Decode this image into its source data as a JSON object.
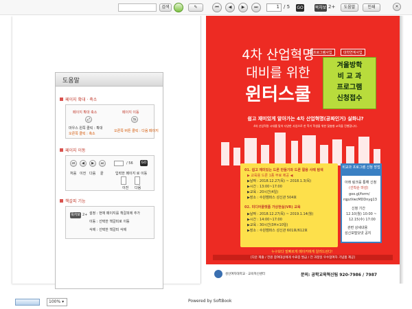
{
  "toolbar": {
    "search_button_label": "검색",
    "page_current": "1",
    "page_total": "/ 5",
    "go_label": "GO",
    "tab_label": "목차보기",
    "tab_extra": "2+",
    "help_label": "도움말",
    "print_label": "인쇄"
  },
  "help": {
    "title": "도움말",
    "section1": "페이지 확대 · 축소",
    "s1_left": "페이지 확대 축소",
    "s1_left_desc": "마우스 왼쪽 클릭 : 확대",
    "s1_left_desc2": "오른쪽 클릭 : 축소",
    "s1_right": "페이지 이동",
    "s1_right_desc": "오른쪽 버튼 클릭 : 다음 페이지",
    "section2": "페이지 이동",
    "s2_page": "/ 56",
    "s2_go": "GO",
    "s2_first": "처음",
    "s2_prev": "이전",
    "s2_next": "다음",
    "s2_last": "끝",
    "s2_input_desc": "입력한 페이지 로 이동",
    "s2_prev2": "이전",
    "s2_next2": "다음",
    "section3": "책갈피 기능",
    "s3_tab": "목차보기",
    "s3_tab_extra": "2+",
    "s3_line1": "설정 : 현재 페이지를 책갈피에 추가",
    "s3_line2": "이동 : 선택한 책갈피로 이동",
    "s3_line3": "삭제 : 선택한 책갈피 삭제"
  },
  "poster": {
    "tag1": "프로그램사업",
    "tag2": "대학연계사업",
    "title_line1": "4차 산업혁명",
    "title_line2": "대비를 위한",
    "title_line3": "윈터스쿨",
    "green_line1": "겨울방학",
    "green_line2": "비 교 과",
    "green_line3": "프로그램",
    "green_line4": "신청접수",
    "question": "쉽고 재미있게 알아가는 4차 산업혁명(공짜인거) 실화냐?",
    "intro": "4차 산업혁명 시대를 맞아 다양한 사업으로 한 학기 학생을 위한 맞춤형 교육을 진행합니다.",
    "p1_title": "01. 쉽고 재미있는 드론 만들기와 드론 활용 사례 탐색",
    "p1_sub": "▶ 교육용 드론 1종 무료 제공 ◀",
    "p1_date": "▶날짜 : 2018.12.27(목) ~ 2018.1.3(목)",
    "p1_time": "▶시간 : 13:00~17:00",
    "p1_hours": "▶교육 : 20시간(4일)",
    "p1_place": "▶장소 : 수원캠퍼스 성신관 504호",
    "p2_title": "02. 미디어플랫폼 가상현실(VR) 교육",
    "p2_date": "▶날짜 : 2018.12.27(목) ~ 2019.1.14(월)",
    "p2_time": "▶시간 : 14:00~17:00",
    "p2_hours": "▶교육 : 30시간(3H×10일)",
    "p2_place": "▶장소 : 수원캠퍼스 성신관 601호/612호",
    "right_title": "비교과 프로그램 신청 방법",
    "right_1": "아래 링크를 통해 신청",
    "right_2": "(선착순 마감)",
    "right_3": "goo.gl/form/",
    "right_4": "rqpzVwcMDDnyg13",
    "right_5": "신청 기간",
    "right_6": "12.10(월) 10:00 ~",
    "right_7": "12.15(수) 17:00",
    "right_8": "관련 상세내용",
    "right_9": "성신포털닷넷 공지",
    "footer_note": "누구보다 발빠르게 메이커에게 알려드린다!",
    "footer_note2": "[다운 제출 / 전원 참여대상에게 수료증 발급 / 전 과정일 우수참여자 기념품 제공]",
    "school": "성신여자대학교 · 교육혁신센터",
    "contact": "문의: 공학교육혁신팀 920-7986 / 7987"
  },
  "bottom": {
    "zoom": "100%",
    "powered": "Powered by SoftBook"
  }
}
